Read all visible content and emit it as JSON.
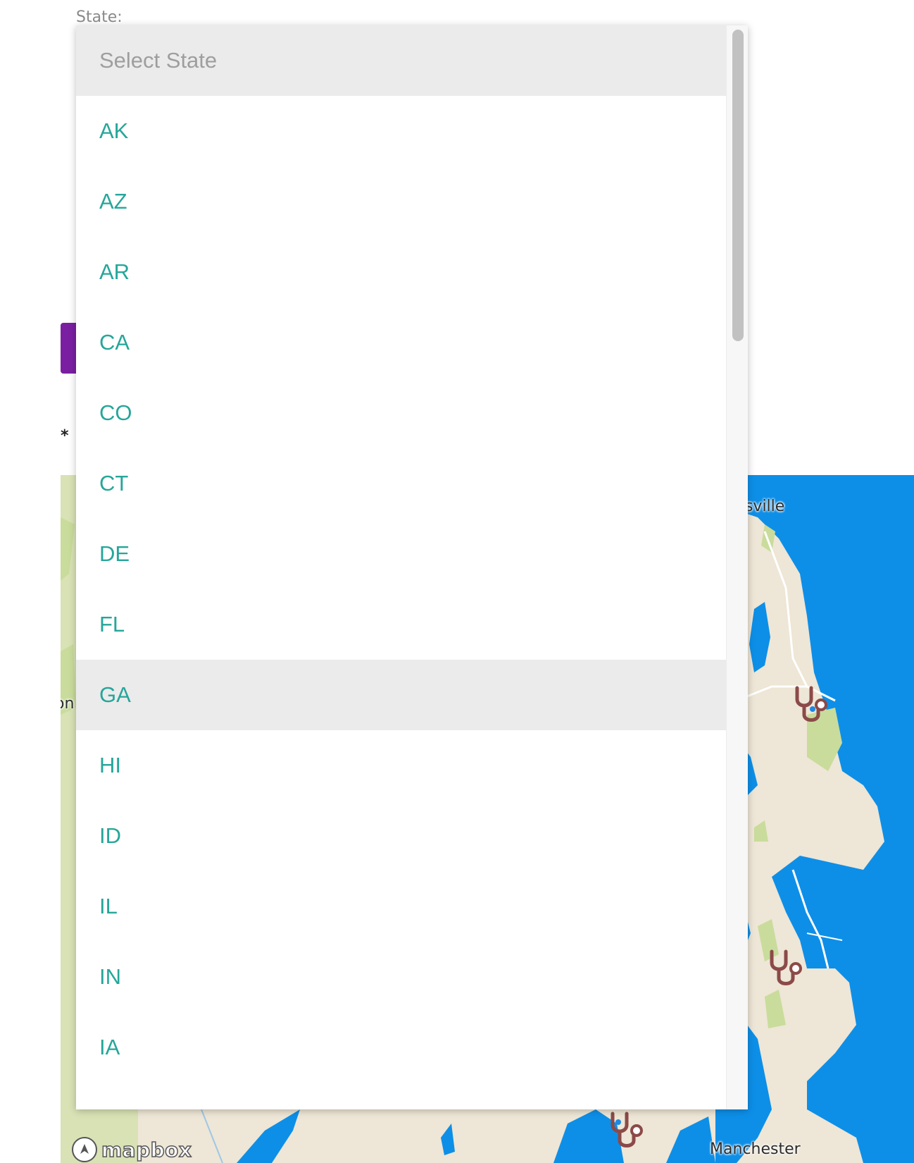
{
  "form": {
    "state_label": "State:",
    "required_marker": "*"
  },
  "dropdown": {
    "placeholder": "Select State",
    "options": [
      "AK",
      "AZ",
      "AR",
      "CA",
      "CO",
      "CT",
      "DE",
      "FL",
      "GA",
      "HI",
      "ID",
      "IL",
      "IN",
      "IA"
    ],
    "highlighted": "GA"
  },
  "map": {
    "labels": {
      "hansville": "Hansville",
      "manchester": "Manchester",
      "partial_left": "on"
    },
    "attribution": "mapbox",
    "marker_icon": "stethoscope-icon",
    "colors": {
      "water": "#0d8fe8",
      "land": "#eee6d6",
      "park": "#c9dc9c",
      "marker": "#8b4a48"
    }
  },
  "colors": {
    "option_text": "#26a69a",
    "placeholder_text": "#9e9e9e",
    "highlight_bg": "#ebebeb",
    "button_purple": "#7b1fa2"
  }
}
